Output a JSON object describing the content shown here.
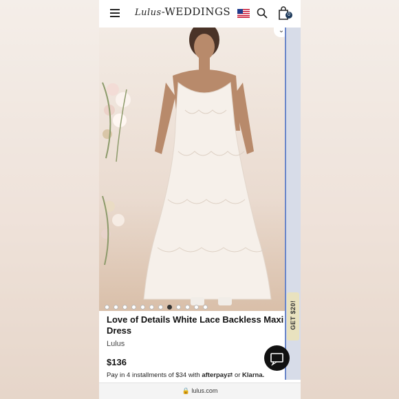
{
  "header": {
    "logo_script": "Lulus",
    "logo_text": "WEDDINGS",
    "bag_count": "0"
  },
  "gallery": {
    "dot_count": 12,
    "active_index": 7
  },
  "promo_tab": {
    "label": "GET $20!"
  },
  "product": {
    "title": "Love of Details White Lace Backless Maxi Dress",
    "brand": "Lulus",
    "price": "$136",
    "installments_prefix": "Pay in 4 installments of $34 with",
    "afterpay": "afterpay",
    "or_text": "or",
    "klarna": "Klarna."
  },
  "browser": {
    "url": "lulus.com"
  },
  "colors": {
    "accent": "#1f3b5c",
    "promo": "#e9e2bf",
    "chat": "#111111"
  }
}
